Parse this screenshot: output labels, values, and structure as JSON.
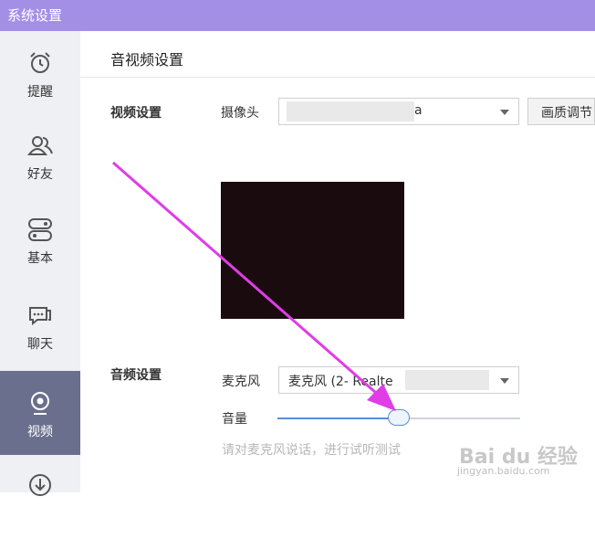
{
  "window": {
    "title": "系统设置"
  },
  "sidebar": {
    "items": [
      {
        "label": "提醒",
        "icon": "alarm-clock-icon",
        "active": false
      },
      {
        "label": "好友",
        "icon": "friends-icon",
        "active": false
      },
      {
        "label": "基本",
        "icon": "toggle-settings-icon",
        "active": false
      },
      {
        "label": "聊天",
        "icon": "chat-bubble-icon",
        "active": false
      },
      {
        "label": "视频",
        "icon": "webcam-icon",
        "active": true
      },
      {
        "label": "",
        "icon": "download-icon",
        "active": false
      }
    ]
  },
  "main": {
    "section_title": "音视频设置",
    "video": {
      "group_label": "视频设置",
      "camera_label": "摄像头",
      "camera_value": "a",
      "quality_button": "画质调节"
    },
    "audio": {
      "group_label": "音频设置",
      "mic_label": "麦克风",
      "mic_value": "麦克风 (2- Realte",
      "volume_label": "音量",
      "volume_level": 0.5,
      "hint": "请对麦克风说话，进行试听测试"
    }
  },
  "watermark": {
    "text": "Bai du 经验",
    "url": "jingyan.baidu.com"
  },
  "colors": {
    "titlebar": "#a38fe6",
    "sidebar_active": "#6a6f8d",
    "accent": "#5b8fd6",
    "annotation_arrow": "#e03ce8"
  }
}
